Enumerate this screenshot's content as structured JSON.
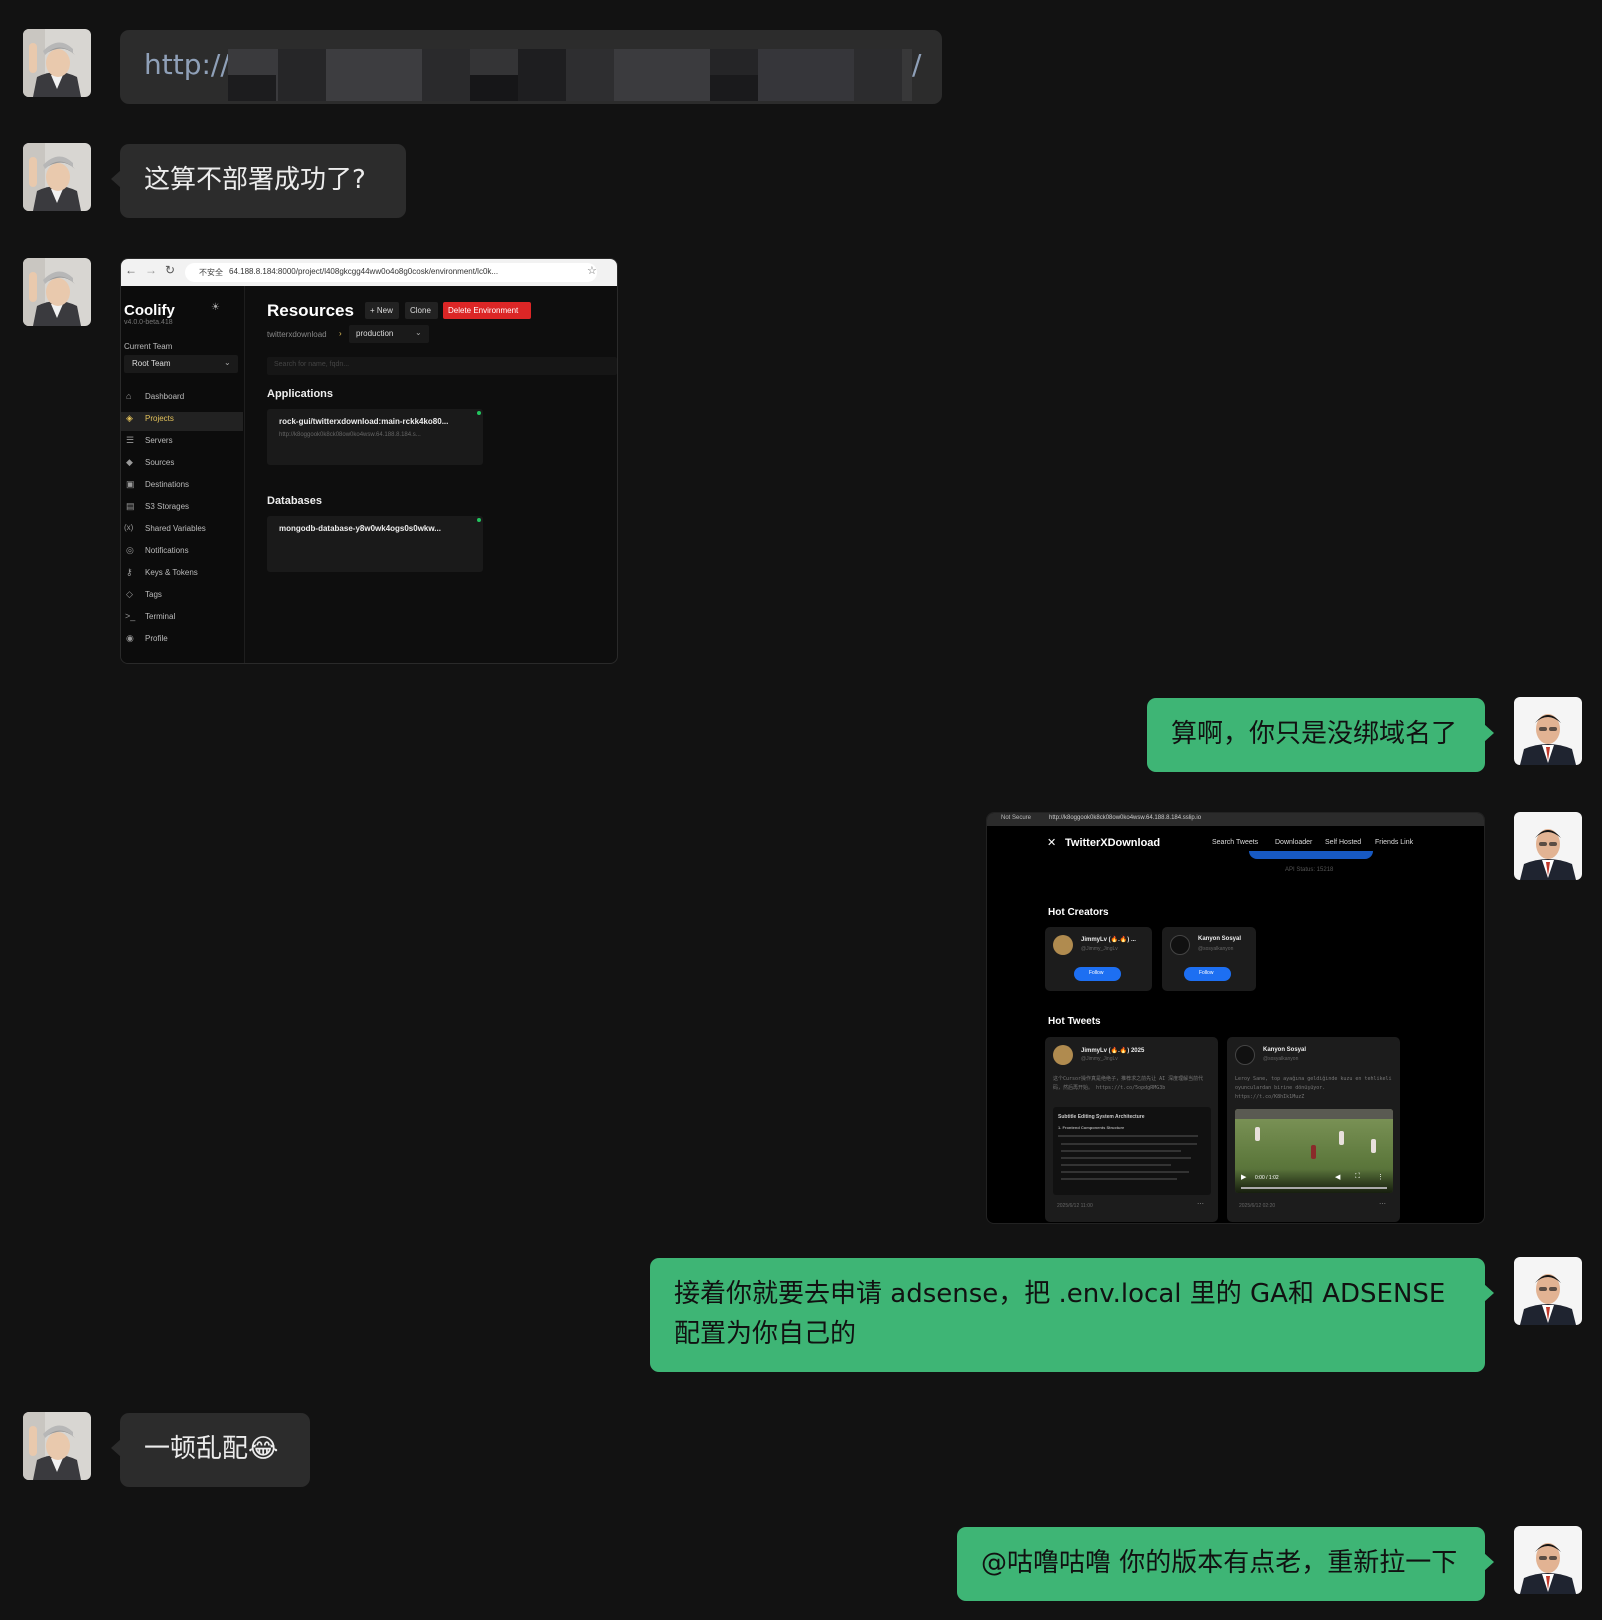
{
  "messages": [
    {
      "text": "http://"
    },
    {
      "text": "这算不部署成功了?"
    },
    {
      "alt": "Coolify resources screenshot"
    },
    {
      "text": "算啊，你只是没绑域名了"
    },
    {
      "alt": "TwitterXDownload screenshot"
    },
    {
      "text": "接着你就要去申请 adsense，把 .env.local 里的 GA和 ADSENSE 配置为你自己的"
    },
    {
      "text": "一顿乱配😂"
    },
    {
      "text": "@咕噜咕噜 你的版本有点老，重新拉一下"
    }
  ],
  "url_trailing": "/",
  "coolify": {
    "url": "64.188.8.184:8000/project/l408gkcgg44ww0o4o8g0cosk/environment/lc0k...",
    "insecure": "不安全",
    "brand": "Coolify",
    "version": "v4.0.0-beta.418",
    "team_label": "Current Team",
    "team_value": "Root Team",
    "nav": [
      "Dashboard",
      "Projects",
      "Servers",
      "Sources",
      "Destinations",
      "S3 Storages",
      "Shared Variables",
      "Notifications",
      "Keys & Tokens",
      "Tags",
      "Terminal",
      "Profile"
    ],
    "title": "Resources",
    "btn_new": "+ New",
    "btn_clone": "Clone",
    "btn_delete": "Delete Environment",
    "breadcrumb": "twitterxdownload",
    "env": "production",
    "search_placeholder": "Search for name, fqdn...",
    "applications_heading": "Applications",
    "app_name": "rock-gui/twitterxdownload:main-rckk4ko80...",
    "app_url": "http://k8oggook0k8ck08ow0ko4wsw.64.188.8.184.s...",
    "databases_heading": "Databases",
    "db_name": "mongodb-database-y8w0wk4ogs0s0wkw..."
  },
  "txd": {
    "insecure": "Not Secure",
    "url": "http://k8oggook0k8ck08ow0ko4wsw.64.188.8.184.sslip.io",
    "brand": "TwitterXDownload",
    "nav": [
      "Search Tweets",
      "Downloader",
      "Self Hosted",
      "Friends Link"
    ],
    "api_status": "API Status: 15218",
    "hot_creators": "Hot Creators",
    "creators": [
      {
        "name": "JimmyLv (🔥.🔥) ...",
        "handle": "@Jimmy_JingLv",
        "follow": "Follow"
      },
      {
        "name": "Kanyon Sosyal",
        "handle": "@sosyalkanyon",
        "follow": "Follow"
      }
    ],
    "hot_tweets": "Hot Tweets",
    "tweets": [
      {
        "name": "JimmyLv (🔥.🔥) 2025",
        "handle": "@Jimmy_JingLv",
        "text": "这个Cursor操作真是绝绝子，推荐求之前先让 AI 深度理解当前代码，然后再开始。 https://t.co/5opdgRMG3b",
        "doc_title": "Subtitle Editing System Architecture",
        "doc_sub": "1. Frontend Components Structure",
        "date": "2025/6/12 11:00"
      },
      {
        "name": "Kanyon Sosyal",
        "handle": "@sosyalkanyon",
        "text": "Leroy Sane, top ayağına geldiğinde kuzu en tehlikeli oyunculardan birine dönüşüyor. https://t.co/K8hIk1MuzZ",
        "video_time": "0:00 / 1:02",
        "date": "2025/6/12 02:20"
      }
    ]
  },
  "colors": {
    "page_bg": "#121212",
    "bubble_left": "#2c2c2c",
    "bubble_right": "#3eb575",
    "coolify_accent": "#e2c15a",
    "danger": "#dc2626",
    "link_blue": "#1d6ff2"
  },
  "icons": {
    "avatar_left": "user-avatar",
    "avatar_right": "contact-avatar"
  }
}
